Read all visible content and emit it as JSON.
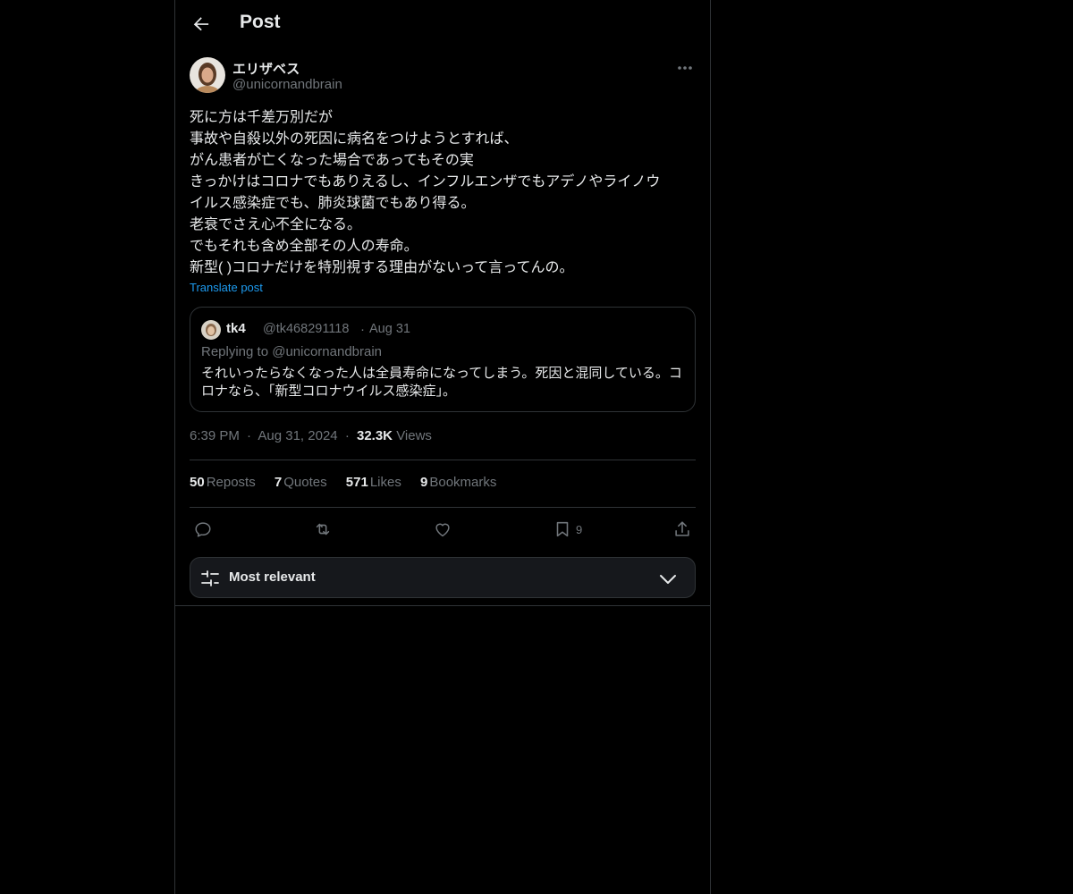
{
  "header": {
    "title": "Post"
  },
  "post": {
    "display_name": "エリザベス",
    "handle": "@unicornandbrain",
    "lines": [
      "死に方は千差万別だが",
      "事故や自殺以外の死因に病名をつけようとすれば、",
      "がん患者が亡くなった場合であってもその実",
      "きっかけはコロナでもありえるし、インフルエンザでもアデノやライノウ",
      "イルス感染症でも、肺炎球菌でもあり得る。",
      "老衰でさえ心不全になる。",
      "でもそれも含め全部その人の寿命。",
      "新型( )コロナだけを特別視する理由がないって言ってんの。"
    ],
    "translate": "Translate post"
  },
  "quote": {
    "name": "tk4",
    "handle": "@tk468291118",
    "dot": "·",
    "date": "Aug 31",
    "replying": "Replying to @unicornandbrain",
    "text": "それいったらなくなった人は全員寿命になってしまう。死因と混同している。コロナなら、「新型コロナウイルス感染症」。"
  },
  "meta": {
    "time": "6:39 PM",
    "dot": "·",
    "date": "Aug 31, 2024",
    "views_count": "32.3K",
    "views_label": "Views"
  },
  "stats": [
    {
      "count": "50",
      "label": "Reposts"
    },
    {
      "count": "7",
      "label": "Quotes"
    },
    {
      "count": "571",
      "label": "Likes"
    },
    {
      "count": "9",
      "label": "Bookmarks"
    }
  ],
  "actions": {
    "reply_icon": "reply-icon",
    "repost_icon": "repost-icon",
    "like_icon": "heart-icon",
    "bookmark_icon": "bookmark-icon",
    "bookmark_count": "9",
    "share_icon": "share-icon"
  },
  "sort": {
    "label": "Most relevant"
  },
  "colors": {
    "background": "#000000",
    "text": "#e7e9ea",
    "muted": "#71767b",
    "accent": "#1d9bf0",
    "border": "#2f3336"
  }
}
